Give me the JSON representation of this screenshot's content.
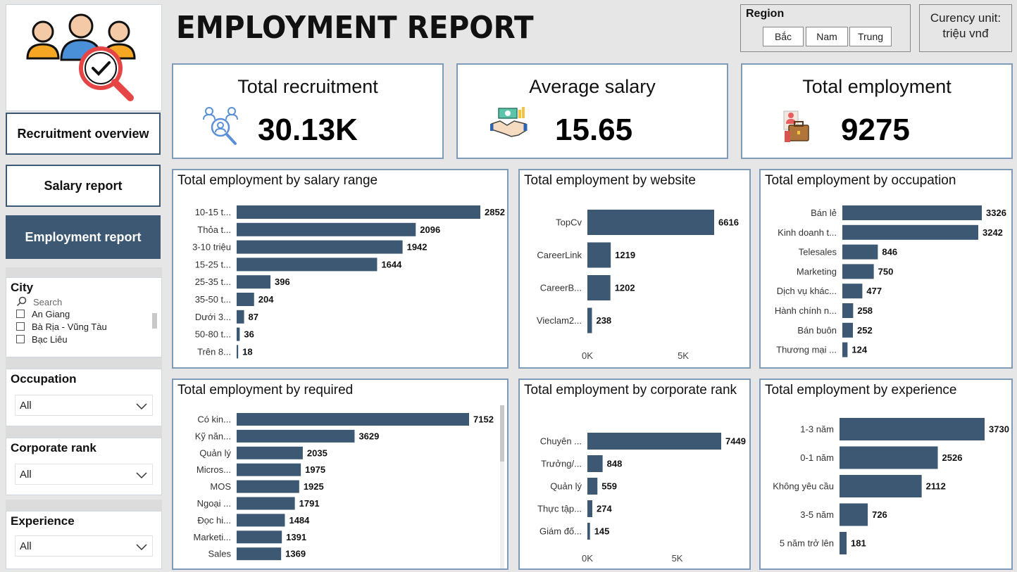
{
  "header": {
    "title": "EMPLOYMENT REPORT"
  },
  "region": {
    "title": "Region",
    "options": [
      "Bắc",
      "Nam",
      "Trung"
    ]
  },
  "currency": {
    "line1": "Curency unit:",
    "line2": "triệu vnđ"
  },
  "nav": [
    {
      "label": "Recruitment overview",
      "active": false
    },
    {
      "label": "Salary report",
      "active": false
    },
    {
      "label": "Employment report",
      "active": true
    }
  ],
  "filters": {
    "city": {
      "title": "City",
      "search_placeholder": "Search",
      "items": [
        "An Giang",
        "Bà Rịa - Vũng Tàu",
        "Bạc Liêu"
      ]
    },
    "occupation": {
      "title": "Occupation",
      "value": "All"
    },
    "corporate_rank": {
      "title": "Corporate rank",
      "value": "All"
    },
    "experience": {
      "title": "Experience",
      "value": "All"
    }
  },
  "kpis": {
    "total_recruitment": {
      "label": "Total recruitment",
      "value": "30.13K",
      "icon": "recruitment-search-icon"
    },
    "average_salary": {
      "label": "Average salary",
      "value": "15.65",
      "icon": "salary-handshake-icon"
    },
    "total_employment": {
      "label": "Total employment",
      "value": "9275",
      "icon": "employment-briefcase-icon"
    }
  },
  "colors": {
    "bar": "#3c5872",
    "card_border": "#7e9bb7",
    "nav_active": "#3c5872"
  },
  "chart_data": [
    {
      "id": "salary",
      "type": "bar",
      "orientation": "horizontal",
      "title": "Total employment by salary range",
      "categories": [
        "10-15 t...",
        "Thỏa t...",
        "3-10 triệu",
        "15-25 t...",
        "25-35 t...",
        "35-50 t...",
        "Dưới 3...",
        "50-80 t...",
        "Trên 8..."
      ],
      "values": [
        2852,
        2096,
        1942,
        1644,
        396,
        204,
        87,
        36,
        18
      ],
      "xlim": [
        0,
        2852
      ]
    },
    {
      "id": "website",
      "type": "bar",
      "orientation": "horizontal",
      "title": "Total employment by website",
      "categories": [
        "TopCv",
        "CareerLink",
        "CareerB...",
        "Vieclam2..."
      ],
      "values": [
        6616,
        1219,
        1202,
        238
      ],
      "xlim": [
        0,
        6616
      ],
      "xticks": [
        {
          "value": 0,
          "label": "0K"
        },
        {
          "value": 5000,
          "label": "5K"
        }
      ]
    },
    {
      "id": "occupation",
      "type": "bar",
      "orientation": "horizontal",
      "title": "Total employment by occupation",
      "categories": [
        "Bán lẻ",
        "Kinh doanh t...",
        "Telesales",
        "Marketing",
        "Dịch vụ khác...",
        "Hành chính n...",
        "Bán buôn",
        "Thương mại ..."
      ],
      "values": [
        3326,
        3242,
        846,
        750,
        477,
        258,
        252,
        124
      ],
      "xlim": [
        0,
        3326
      ]
    },
    {
      "id": "required",
      "type": "bar",
      "orientation": "horizontal",
      "title": "Total employment by required",
      "categories": [
        "Có kin...",
        "Kỹ năn...",
        "Quản lý",
        "Micros...",
        "MOS",
        "Ngoại ...",
        "Đọc hi...",
        "Marketi...",
        "Sales"
      ],
      "values": [
        7152,
        3629,
        2035,
        1975,
        1925,
        1791,
        1484,
        1391,
        1369
      ],
      "xlim": [
        0,
        7152
      ]
    },
    {
      "id": "rank",
      "type": "bar",
      "orientation": "horizontal",
      "title": "Total employment by corporate rank",
      "categories": [
        "Chuyên ...",
        "Trưởng/...",
        "Quản lý",
        "Thực tập...",
        "Giám đố..."
      ],
      "values": [
        7449,
        848,
        559,
        274,
        145
      ],
      "xlim": [
        0,
        7449
      ],
      "xticks": [
        {
          "value": 0,
          "label": "0K"
        },
        {
          "value": 5000,
          "label": "5K"
        }
      ]
    },
    {
      "id": "experience",
      "type": "bar",
      "orientation": "horizontal",
      "title": "Total employment by experience",
      "categories": [
        "1-3 năm",
        "0-1 năm",
        "Không yêu cầu",
        "3-5 năm",
        "5 năm trở lên"
      ],
      "values": [
        3730,
        2526,
        2112,
        726,
        181
      ],
      "xlim": [
        0,
        3730
      ]
    }
  ]
}
